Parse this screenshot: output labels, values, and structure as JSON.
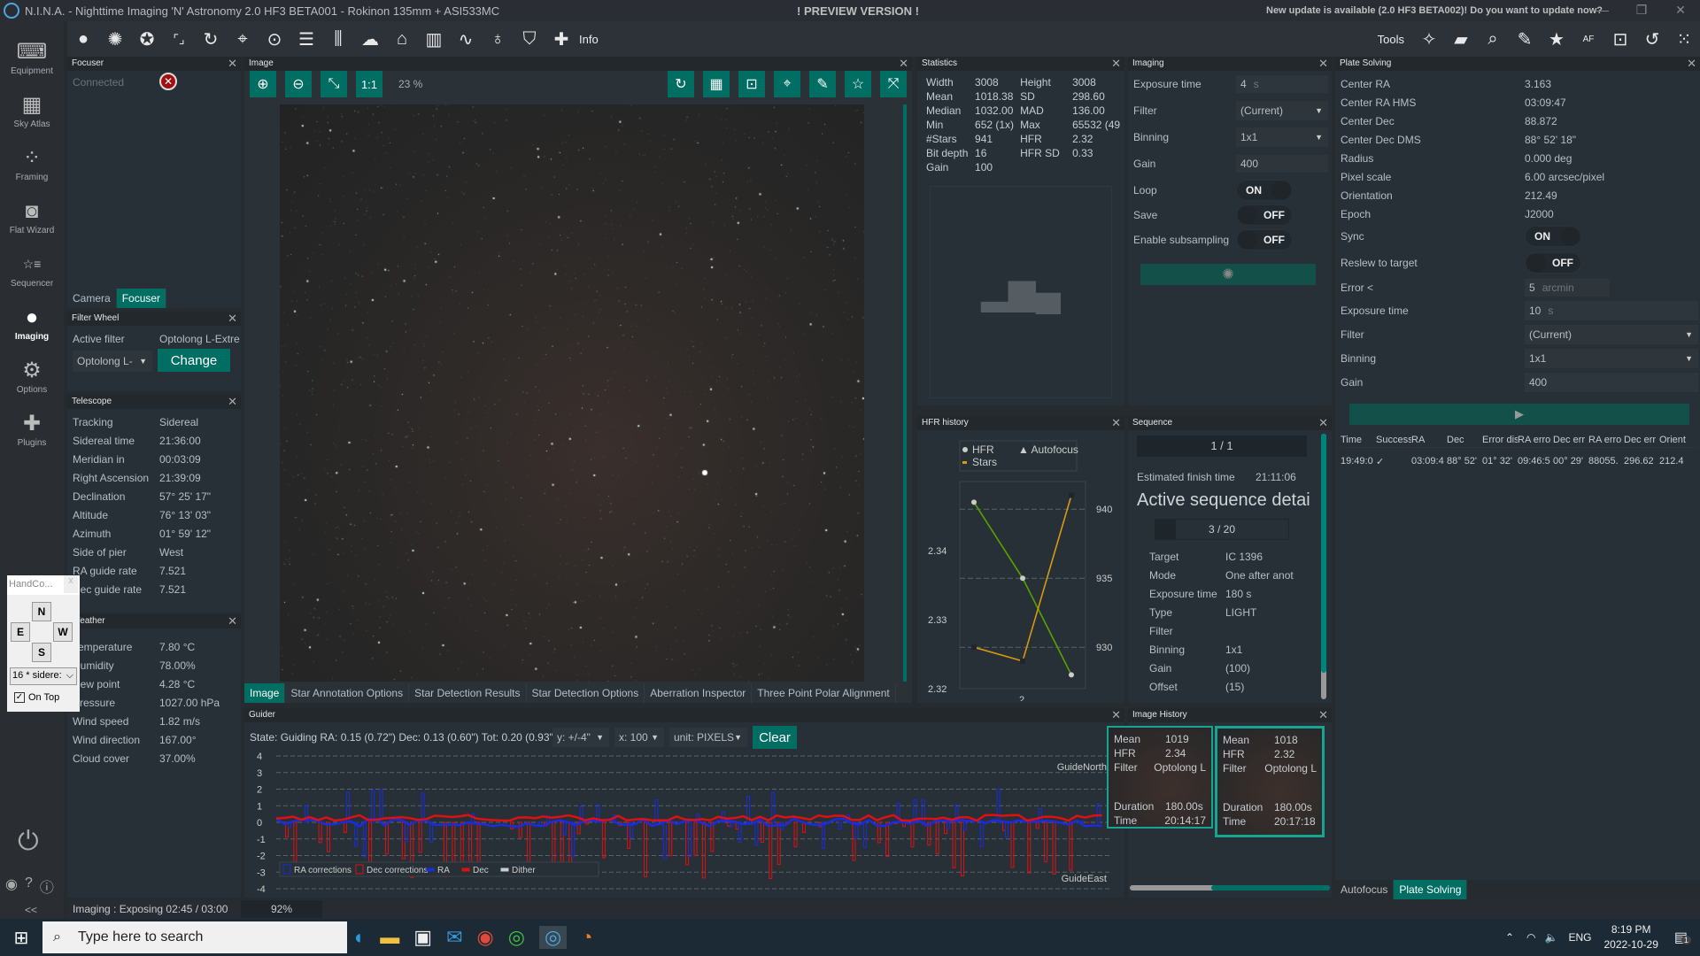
{
  "window": {
    "title": "N.I.N.A. - Nighttime Imaging 'N' Astronomy 2.0 HF3 BETA001  -  Rokinon 135mm + ASI533MC",
    "preview": "! PREVIEW VERSION !",
    "update": "New update is available (2.0 HF3 BETA002)! Do you want to update now?",
    "controls": [
      "minimize",
      "maximize",
      "close"
    ]
  },
  "toolbar": {
    "info_label": "Info",
    "tools_label": "Tools",
    "icons": [
      "sky-sphere",
      "camera-shutter",
      "filter-wheel",
      "focuser",
      "rotator",
      "telescope",
      "guider",
      "sequencer",
      "switch",
      "weather",
      "dome",
      "statistics",
      "hfr-graph",
      "flat-panel",
      "safety-monitor",
      "plugins"
    ]
  },
  "sidebar": {
    "items": [
      {
        "label": "Equipment",
        "icon": "plug-laptop"
      },
      {
        "label": "Sky Atlas",
        "icon": "map"
      },
      {
        "label": "Framing",
        "icon": "constellation"
      },
      {
        "label": "Flat Wizard",
        "icon": "flat-wizard"
      },
      {
        "label": "Sequencer",
        "icon": "list-stars"
      },
      {
        "label": "Imaging",
        "icon": "sky-sphere",
        "active": true
      },
      {
        "label": "Options",
        "icon": "gears"
      },
      {
        "label": "Plugins",
        "icon": "puzzle"
      }
    ],
    "collapse": "<<"
  },
  "focuser": {
    "title": "Focuser",
    "connected_label": "Connected",
    "tabs": [
      "Camera",
      "Focuser"
    ],
    "active_tab": "Focuser"
  },
  "filter_wheel": {
    "title": "Filter Wheel",
    "active_filter_label": "Active filter",
    "active_filter_value": "Optolong L-Extre",
    "select_value": "Optolong L-",
    "change_label": "Change"
  },
  "telescope": {
    "title": "Telescope",
    "rows": [
      {
        "k": "Tracking",
        "v": "Sidereal"
      },
      {
        "k": "Sidereal time",
        "v": "21:36:00"
      },
      {
        "k": "Meridian in",
        "v": "00:03:09"
      },
      {
        "k": "Right Ascension",
        "v": "21:39:09"
      },
      {
        "k": "Declination",
        "v": "57° 25' 17\""
      },
      {
        "k": "Altitude",
        "v": "76° 13' 03\""
      },
      {
        "k": "Azimuth",
        "v": "01° 59' 12\""
      },
      {
        "k": "Side of pier",
        "v": "West"
      },
      {
        "k": "RA guide rate",
        "v": "7.521"
      },
      {
        "k": "Dec guide rate",
        "v": "7.521"
      }
    ]
  },
  "weather": {
    "title": "Weather",
    "rows": [
      {
        "k": "Temperature",
        "v": "7.80 °C"
      },
      {
        "k": "Humidity",
        "v": "78.00%"
      },
      {
        "k": "Dew point",
        "v": "4.28 °C"
      },
      {
        "k": "Pressure",
        "v": "1027.00 hPa"
      },
      {
        "k": "Wind speed",
        "v": "1.82 m/s"
      },
      {
        "k": "Wind direction",
        "v": "167.00°"
      },
      {
        "k": "Cloud cover",
        "v": "37.00%"
      }
    ]
  },
  "hand_controller": {
    "title": "HandCo...",
    "n": "N",
    "s": "S",
    "e": "E",
    "w": "W",
    "rate": "16 * sidere:",
    "on_top": "On Top",
    "on_top_checked": true
  },
  "image": {
    "title": "Image",
    "zoom": "23 %",
    "one_to_one": "1:1",
    "tabs": [
      "Image",
      "Star Annotation Options",
      "Star Detection Results",
      "Star Detection Options",
      "Aberration Inspector",
      "Three Point Polar Alignment"
    ],
    "active_tab": "Image"
  },
  "statistics": {
    "title": "Statistics",
    "rows": [
      [
        "Width",
        "3008",
        "Height",
        "3008"
      ],
      [
        "Mean",
        "1018.38",
        "SD",
        "298.60"
      ],
      [
        "Median",
        "1032.00",
        "MAD",
        "136.00"
      ],
      [
        "Min",
        "652 (1x)",
        "Max",
        "65532 (49"
      ],
      [
        "#Stars",
        "941",
        "HFR",
        "2.32"
      ],
      [
        "Bit depth",
        "16",
        "HFR SD",
        "0.33"
      ],
      [
        "Gain",
        "100",
        "",
        ""
      ]
    ]
  },
  "imaging": {
    "title": "Imaging",
    "exposure_label": "Exposure time",
    "exposure": "4",
    "exposure_unit": "s",
    "filter_label": "Filter",
    "filter": "(Current)",
    "binning_label": "Binning",
    "binning": "1x1",
    "gain_label": "Gain",
    "gain": "400",
    "loop_label": "Loop",
    "loop": "ON",
    "save_label": "Save",
    "save": "OFF",
    "subsampling_label": "Enable subsampling",
    "subsampling": "OFF"
  },
  "plate_solving": {
    "title": "Plate Solving",
    "rows": [
      {
        "k": "Center RA",
        "v": "3.163"
      },
      {
        "k": "Center RA HMS",
        "v": "03:09:47"
      },
      {
        "k": "Center Dec",
        "v": "88.872"
      },
      {
        "k": "Center Dec DMS",
        "v": "88° 52' 18\""
      },
      {
        "k": "Radius",
        "v": "0.000 deg"
      },
      {
        "k": "Pixel scale",
        "v": "6.00 arcsec/pixel"
      },
      {
        "k": "Orientation",
        "v": "212.49"
      },
      {
        "k": "Epoch",
        "v": "J2000"
      }
    ],
    "sync_label": "Sync",
    "sync": "ON",
    "reslew_label": "Reslew to target",
    "reslew": "OFF",
    "error_label": "Error <",
    "error": "5",
    "error_unit": "arcmin",
    "exposure_label": "Exposure time",
    "exposure": "10",
    "exposure_unit": "s",
    "filter_label": "Filter",
    "filter": "(Current)",
    "binning_label": "Binning",
    "binning": "1x1",
    "gain_label": "Gain",
    "gain": "400",
    "table_headers": [
      "Time",
      "Success",
      "RA",
      "Dec",
      "Error dis",
      "RA erro",
      "Dec err",
      "RA erro",
      "Dec err",
      "Orient"
    ],
    "table_row": [
      "19:49:0",
      "✓",
      "03:09:4",
      "88° 52'",
      "01° 32'",
      "09:46:5",
      "00° 29'",
      "88055.",
      "296.62",
      "212.4"
    ],
    "tabs": [
      "Autofocus",
      "Plate Solving"
    ],
    "active_tab": "Plate Solving"
  },
  "hfr_history": {
    "title": "HFR history",
    "legend": [
      "HFR",
      "Autofocus",
      "Stars"
    ]
  },
  "sequence": {
    "title": "Sequence",
    "progress": "1 / 1",
    "eta_label": "Estimated finish time",
    "eta": "21:11:06",
    "heading": "Active sequence detai",
    "sub_progress": "3 / 20",
    "sub_progress_fraction": 0.15,
    "rows": [
      {
        "k": "Target",
        "v": "IC 1396"
      },
      {
        "k": "Mode",
        "v": "One after anot"
      },
      {
        "k": "Exposure time",
        "v": "180 s"
      },
      {
        "k": "Type",
        "v": "LIGHT"
      },
      {
        "k": "Filter",
        "v": ""
      },
      {
        "k": "Binning",
        "v": "1x1"
      },
      {
        "k": "Gain",
        "v": "(100)"
      },
      {
        "k": "Offset",
        "v": "(15)"
      }
    ]
  },
  "guider": {
    "title": "Guider",
    "state": "State: Guiding  RA: 0.15 (0.72\")  Dec: 0.13 (0.60\")  Tot: 0.20 (0.93\")",
    "y_scale": "y: +/-4\"",
    "x_scale": "x: 100",
    "unit": "unit: PIXELS",
    "clear": "Clear",
    "north": "GuideNorth",
    "east": "GuideEast",
    "legend": [
      "RA corrections",
      "Dec corrections",
      "RA",
      "Dec",
      "Dither"
    ]
  },
  "image_history": {
    "title": "Image History",
    "items": [
      {
        "mean": "1019",
        "hfr": "2.34",
        "filter": "Optolong L",
        "duration": "180.00s",
        "time": "20:14:17"
      },
      {
        "mean": "1018",
        "hfr": "2.32",
        "filter": "Optolong L",
        "duration": "180.00s",
        "time": "20:17:18"
      }
    ],
    "labels": {
      "mean": "Mean",
      "hfr": "HFR",
      "filter": "Filter",
      "duration": "Duration",
      "time": "Time"
    }
  },
  "status": {
    "text": "Imaging :   Exposing 02:45 / 03:00",
    "percent": "92%",
    "fraction": 0.92
  },
  "taskbar": {
    "search_placeholder": "Type here to search",
    "time": "8:19 PM",
    "date": "2022-10-29",
    "lang": "ENG",
    "notifications": "1"
  },
  "chart_data": [
    {
      "type": "line",
      "title": "HFR history",
      "x": [
        1,
        2,
        3
      ],
      "xticks": [
        "2"
      ],
      "series": [
        {
          "name": "HFR",
          "axis": "left",
          "values": [
            2.347,
            2.336,
            2.322
          ],
          "color": "#5aa000"
        },
        {
          "name": "Stars",
          "axis": "right",
          "values": [
            930,
            929,
            941
          ],
          "color": "#d89a10"
        }
      ],
      "ylim_left": [
        2.32,
        2.35
      ],
      "yticks_left": [
        "2.32",
        "2.33",
        "2.34"
      ],
      "ylim_right": [
        927,
        942
      ],
      "yticks_right": [
        "930",
        "935",
        "940"
      ],
      "legend": "top"
    },
    {
      "type": "line",
      "title": "Guider",
      "ylim": [
        -4,
        4
      ],
      "yticks": [
        "4",
        "3",
        "2",
        "1",
        "0",
        "-1",
        "-2",
        "-3",
        "-4"
      ],
      "xlim": [
        0,
        100
      ],
      "series": [
        {
          "name": "RA",
          "color": "#1a2ce0"
        },
        {
          "name": "Dec",
          "color": "#e01010"
        },
        {
          "name": "RA corrections",
          "color": "#1a2ce0"
        },
        {
          "name": "Dec corrections",
          "color": "#e01010"
        }
      ],
      "legend": "bottom-left"
    }
  ]
}
